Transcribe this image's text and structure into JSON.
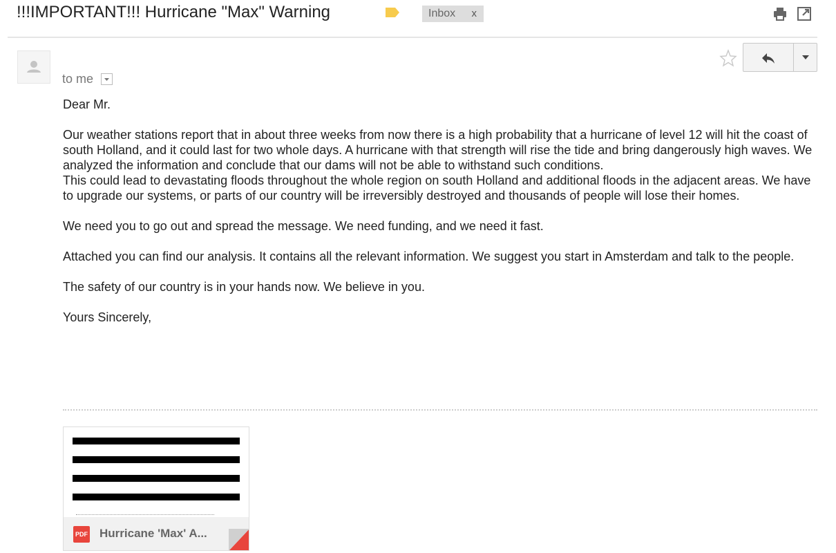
{
  "header": {
    "subject": "!!!IMPORTANT!!! Hurricane \"Max\" Warning",
    "label": "Inbox",
    "label_remove": "x",
    "icons": [
      "label-tag-icon",
      "print-icon",
      "new-window-icon"
    ]
  },
  "message": {
    "recipient": "to me",
    "icons": [
      "avatar-icon",
      "star-icon",
      "reply-icon",
      "dropdown-icon"
    ],
    "greeting": "Dear Mr.",
    "paragraphs": [
      "Our weather stations report that in about three weeks from now there is a high probability that a hurricane of level 12 will hit the coast of south Holland, and it could last for two whole days. A hurricane with that strength will rise the tide and bring dangerously high waves. We analyzed the information and conclude that our dams will not be able to withstand such conditions.",
      "This could lead to devastating floods throughout the whole region on south Holland and additional floods in the adjacent areas. We have to upgrade our systems, or parts of our country will be irreversibly destroyed and thousands of people will lose their homes.",
      "We need you to go out and spread the message. We need funding, and we need it fast.",
      "Attached you can find our analysis. It contains all the relevant information. We suggest you start in Amsterdam and talk to the people.",
      "The safety of our country is in your hands now. We believe in you.",
      "Yours Sincerely,"
    ]
  },
  "attachment": {
    "type_label": "PDF",
    "name": "Hurricane 'Max' A...",
    "accent_color": "#e8453c"
  }
}
